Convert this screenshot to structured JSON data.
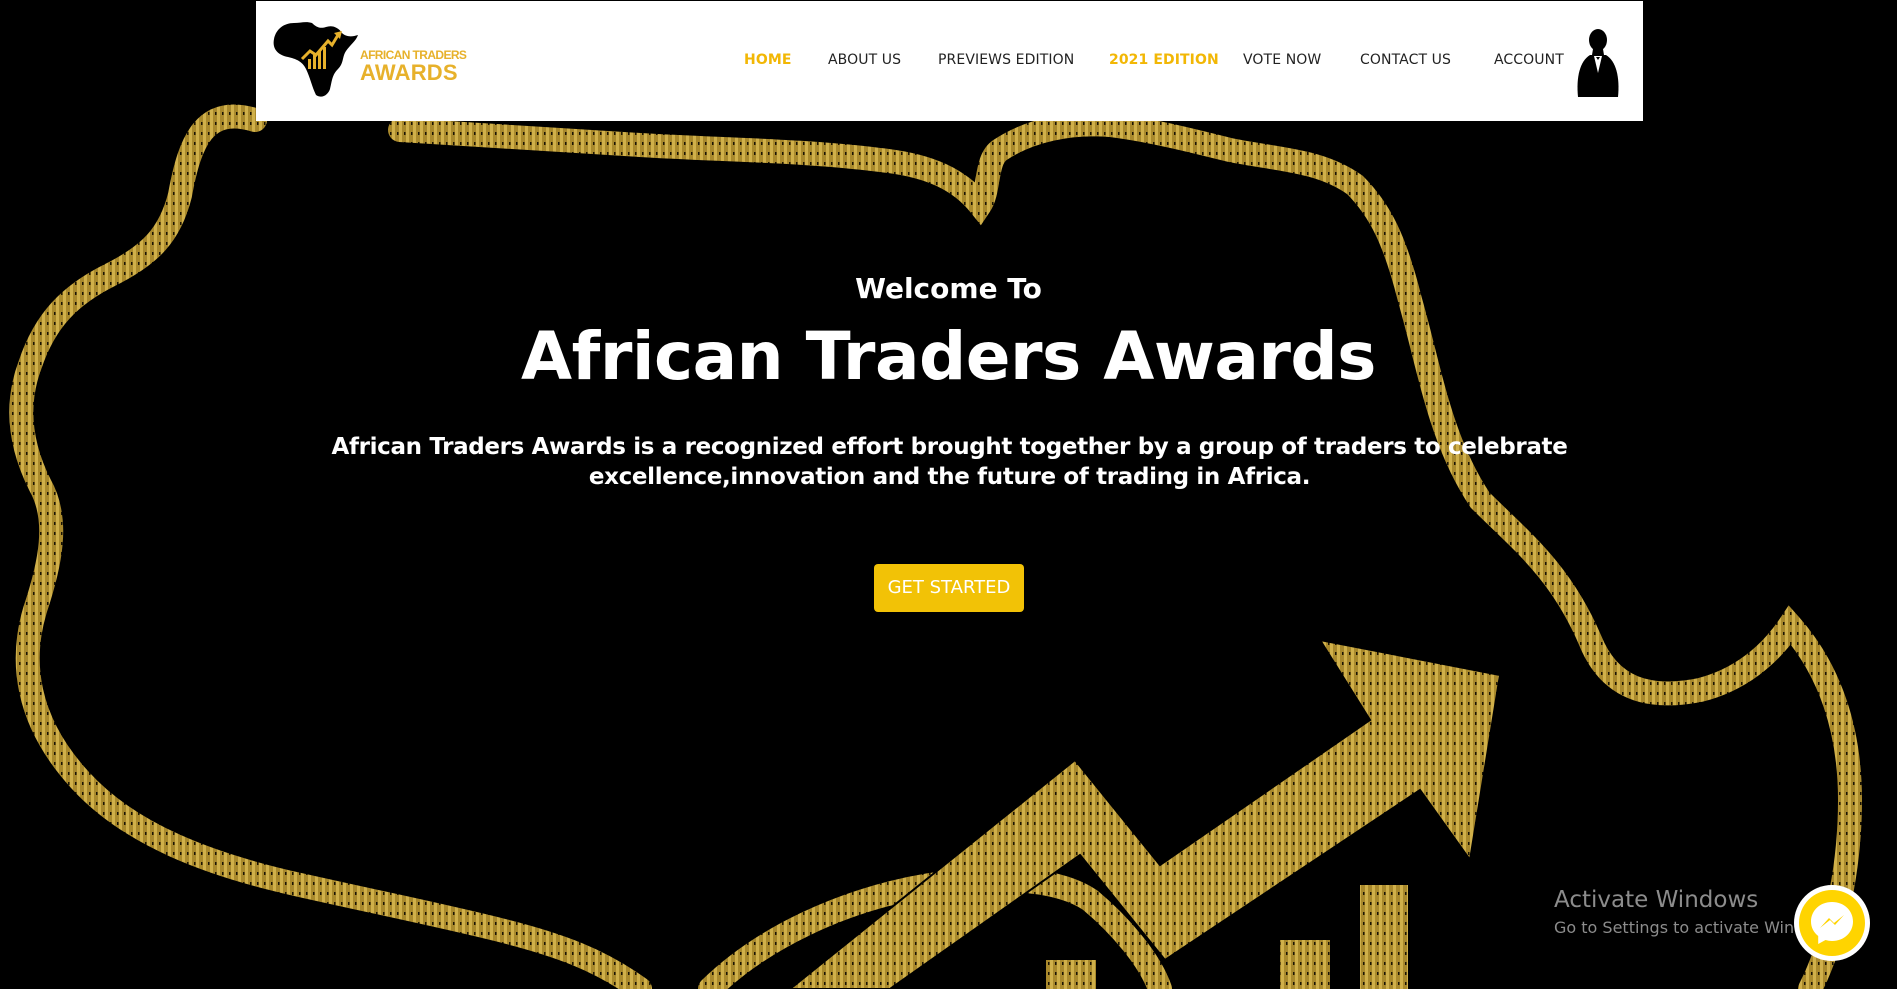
{
  "header": {
    "logo": {
      "line1": "AFRICAN TRADERS",
      "line2": "AWARDS",
      "icon": "africa-map-chart-icon"
    },
    "nav": [
      {
        "label": "HOME",
        "active": true
      },
      {
        "label": "ABOUT US",
        "active": false
      },
      {
        "label": "PREVIEWS EDITION",
        "active": false
      },
      {
        "label": "2021 EDITION",
        "active": true
      },
      {
        "label": "VOTE NOW",
        "active": false
      },
      {
        "label": "CONTACT US",
        "active": false
      },
      {
        "label": "ACCOUNT",
        "active": false
      }
    ],
    "account_icon": "user-avatar-icon"
  },
  "hero": {
    "welcome": "Welcome To",
    "title": "African Traders Awards",
    "description": "African Traders Awards is a recognized effort brought together by a group of traders to celebrate excellence,innovation and the future of trading in Africa.",
    "cta_label": "GET STARTED",
    "background_icon": "africa-map-growth-arrow-icon"
  },
  "watermark": {
    "title": "Activate Windows",
    "subtitle": "Go to Settings to activate Windows."
  },
  "chat": {
    "icon": "messenger-icon"
  },
  "colors": {
    "accent": "#f2b705",
    "button": "#f2c206",
    "gold_pattern": "#b8942e",
    "background": "#000000",
    "header_bg": "#ffffff"
  }
}
